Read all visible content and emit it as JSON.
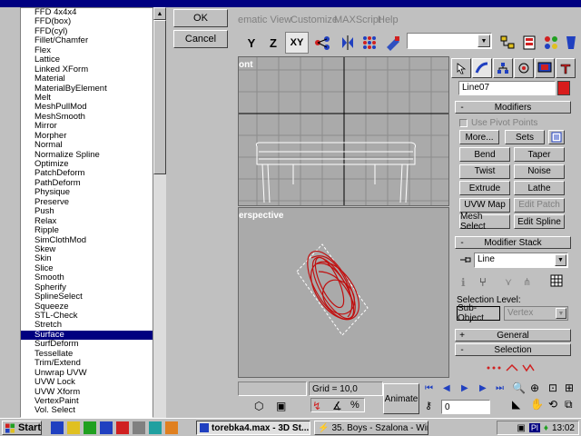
{
  "dialog": {
    "ok_label": "OK",
    "cancel_label": "Cancel",
    "modifiers": [
      "FFD 4x4x4",
      "FFD(box)",
      "FFD(cyl)",
      "Fillet/Chamfer",
      "Flex",
      "Lattice",
      "Linked XForm",
      "Material",
      "MaterialByElement",
      "Melt",
      "MeshPullMod",
      "MeshSmooth",
      "Mirror",
      "Morpher",
      "Normal",
      "Normalize Spline",
      "Optimize",
      "PatchDeform",
      "PathDeform",
      "Physique",
      "Preserve",
      "Push",
      "Relax",
      "Ripple",
      "SimClothMod",
      "Skew",
      "Skin",
      "Slice",
      "Smooth",
      "Spherify",
      "SplineSelect",
      "Squeeze",
      "STL-Check",
      "Stretch",
      "Surface",
      "SurfDeform",
      "Tessellate",
      "Trim/Extend",
      "Unwrap UVW",
      "UVW Lock",
      "UVW Xform",
      "VertexPaint",
      "Vol. Select"
    ],
    "selected_modifier": "Surface"
  },
  "menubar": {
    "items": [
      "ematic View",
      "Customize",
      "MAXScript",
      "Help"
    ]
  },
  "toolbar": {
    "y_label": "Y",
    "z_label": "Z",
    "xy_label": "XY"
  },
  "viewports": {
    "front_label": "ont",
    "perspective_label": "erspective"
  },
  "command_panel": {
    "object_name": "Line07",
    "object_color": "#d81c1c",
    "modifiers_title": "Modifiers",
    "use_pivot_points": "Use Pivot Points",
    "more_label": "More...",
    "sets_label": "Sets",
    "buttons": [
      "Bend",
      "Taper",
      "Twist",
      "Noise",
      "Extrude",
      "Lathe",
      "UVW Map",
      "Edit Patch",
      "Mesh Select",
      "Edit Spline"
    ],
    "disabled_buttons": [
      "Edit Patch"
    ],
    "modifier_stack_title": "Modifier Stack",
    "stack_value": "Line",
    "selection_level_label": "Selection Level:",
    "subobject_label": "Sub-Object",
    "subobject_value": "Vertex",
    "general_title": "General",
    "selection_title": "Selection",
    "minus": "-",
    "plus": "+"
  },
  "bottom": {
    "grid_label": "Grid = 10,0",
    "animate_label": "Animate",
    "frame_value": "0"
  },
  "taskbar": {
    "start_label": "Start",
    "task_max": "torebka4.max - 3D St...",
    "task_winamp": "35. Boys - Szalona - Winamp",
    "tray_pl": "Pl",
    "clock": "13:02"
  }
}
